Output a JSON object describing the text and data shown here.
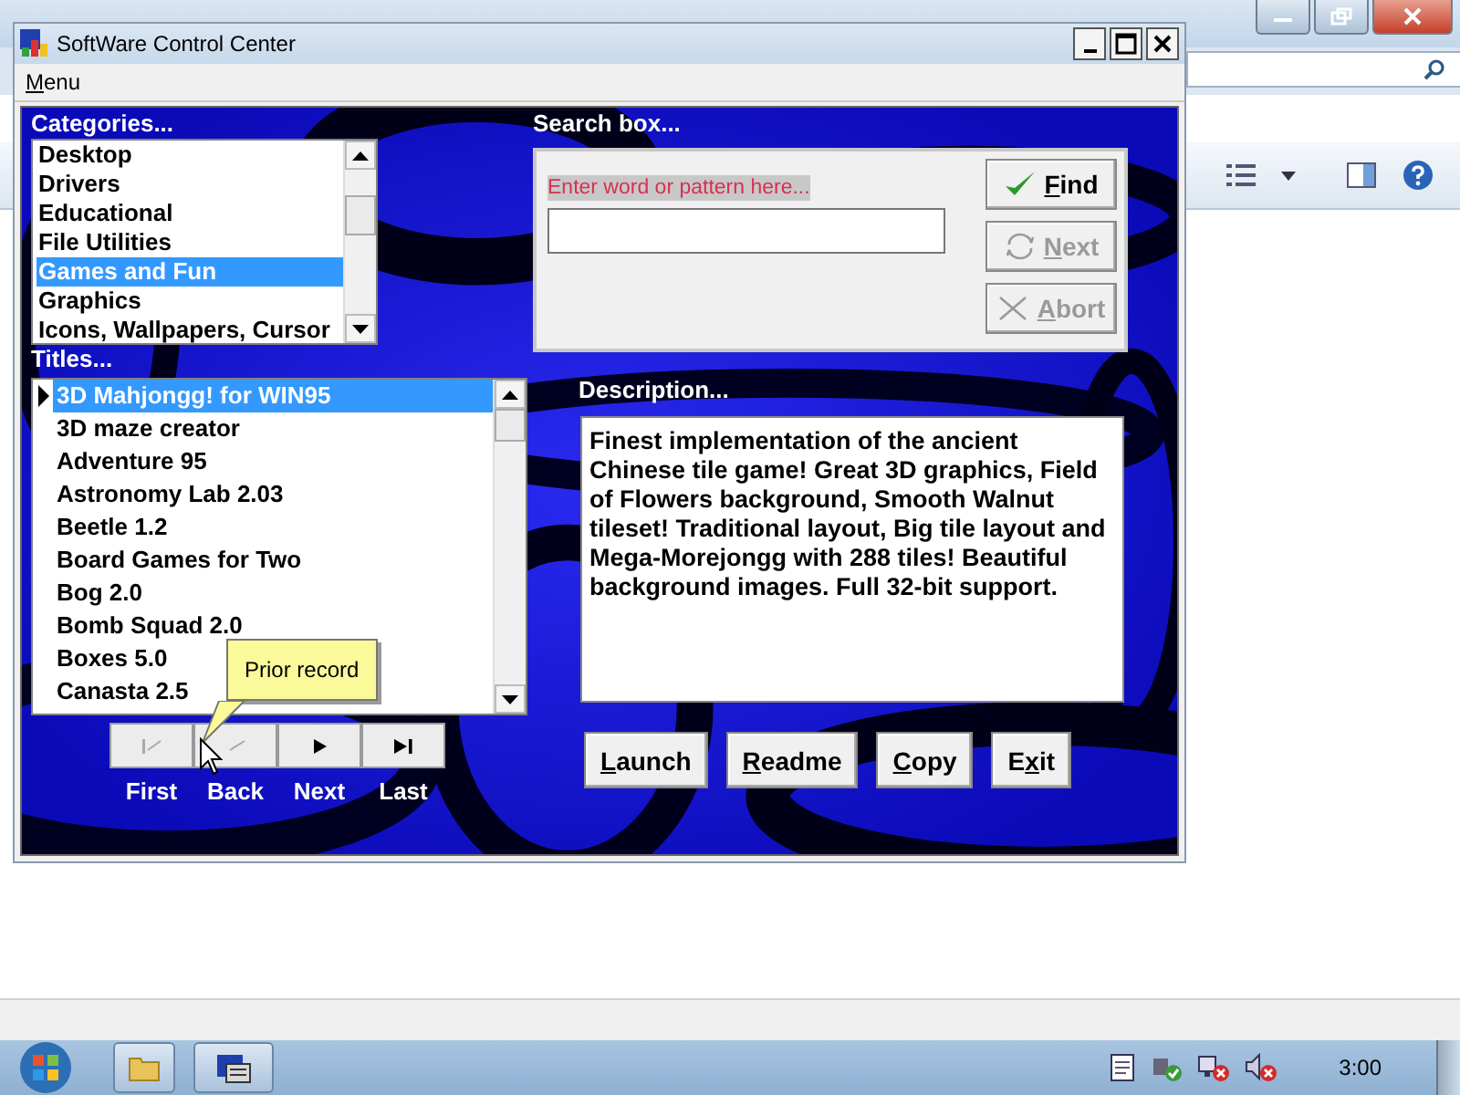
{
  "window": {
    "title": "SoftWare Control Center"
  },
  "menu": [
    {
      "key": "M",
      "post": "enu"
    }
  ],
  "categories": {
    "label": "Categories...",
    "items": [
      {
        "label": "Desktop",
        "selected": false
      },
      {
        "label": "Drivers",
        "selected": false
      },
      {
        "label": "Educational",
        "selected": false
      },
      {
        "label": "File Utilities",
        "selected": false
      },
      {
        "label": "Games and Fun",
        "selected": true
      },
      {
        "label": "Graphics",
        "selected": false
      },
      {
        "label": "Icons, Wallpapers, Cursor",
        "selected": false
      }
    ]
  },
  "titles": {
    "label": "Titles...",
    "items": [
      {
        "label": "3D Mahjongg! for WIN95",
        "selected": true
      },
      {
        "label": "3D maze creator",
        "selected": false
      },
      {
        "label": "Adventure 95",
        "selected": false
      },
      {
        "label": "Astronomy Lab 2.03",
        "selected": false
      },
      {
        "label": "Beetle 1.2",
        "selected": false
      },
      {
        "label": "Board Games for Two",
        "selected": false
      },
      {
        "label": "Bog 2.0",
        "selected": false
      },
      {
        "label": "Bomb Squad 2.0",
        "selected": false
      },
      {
        "label": "Boxes 5.0",
        "selected": false
      },
      {
        "label": "Canasta 2.5",
        "selected": false
      }
    ]
  },
  "navigation": [
    {
      "kind": "first",
      "label": "First",
      "disabled": true
    },
    {
      "kind": "back",
      "label": "Back",
      "disabled": true
    },
    {
      "kind": "next",
      "label": "Next",
      "disabled": false
    },
    {
      "kind": "last",
      "label": "Last",
      "disabled": false
    }
  ],
  "tooltip": "Prior record",
  "search": {
    "label": "Search box...",
    "prompt": "Enter word or pattern here...",
    "buttons": [
      {
        "kind": "find",
        "key": "F",
        "post": "ind",
        "disabled": false
      },
      {
        "kind": "next",
        "key": "N",
        "post": "ext",
        "disabled": true
      },
      {
        "kind": "abort",
        "key": "A",
        "post": "bort",
        "disabled": true
      }
    ]
  },
  "description": {
    "label": "Description...",
    "text": "Finest implementation of the ancient Chinese tile game! Great 3D graphics, Field of Flowers background, Smooth Walnut tileset! Traditional layout, Big tile layout and Mega-Morejongg with 288 tiles! Beautiful background images. Full 32-bit support."
  },
  "actions": [
    {
      "key": "L",
      "post": "aunch"
    },
    {
      "key": "R",
      "post": "eadme"
    },
    {
      "key": "C",
      "post": "opy"
    },
    {
      "pre": "E",
      "key": "x",
      "post": "it"
    }
  ],
  "taskbar": {
    "clock": "3:00"
  }
}
